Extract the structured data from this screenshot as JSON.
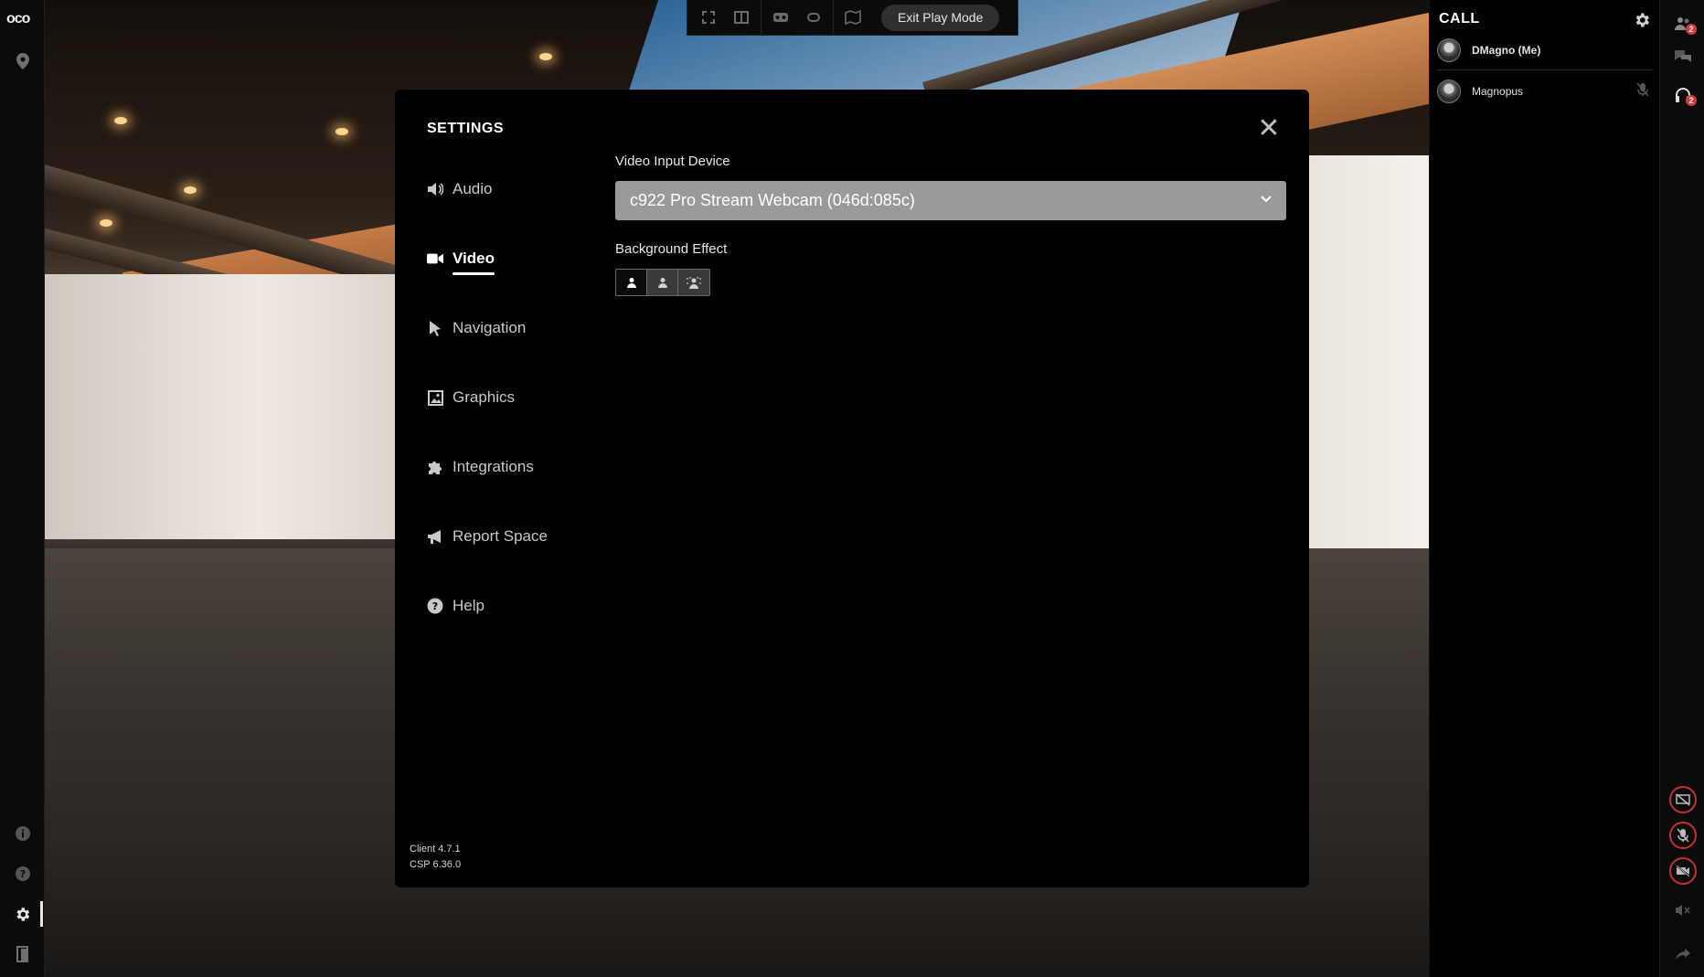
{
  "app": {
    "logo_text": "oco"
  },
  "toolbar": {
    "exit_label": "Exit Play Mode"
  },
  "left_rail": {
    "top_icons": [
      "location-pin-icon"
    ],
    "bottom_icons": [
      "info-icon",
      "help-icon",
      "gear-icon",
      "exit-door-icon"
    ],
    "active": "gear-icon"
  },
  "settings": {
    "title": "SETTINGS",
    "nav": [
      {
        "label": "Audio",
        "icon": "speaker-icon"
      },
      {
        "label": "Video",
        "icon": "video-camera-icon",
        "active": true
      },
      {
        "label": "Navigation",
        "icon": "pointer-icon"
      },
      {
        "label": "Graphics",
        "icon": "image-icon"
      },
      {
        "label": "Integrations",
        "icon": "puzzle-icon"
      },
      {
        "label": "Report Space",
        "icon": "megaphone-icon"
      },
      {
        "label": "Help",
        "icon": "help-circle-icon"
      }
    ],
    "video_input_label": "Video Input Device",
    "video_input_value": "c922 Pro Stream Webcam (046d:085c)",
    "background_effect_label": "Background Effect",
    "background_effect_options": [
      "none",
      "blur",
      "virtual-background"
    ],
    "background_effect_selected": "none",
    "client_version": "Client 4.7.1",
    "csp_version": "CSP 6.36.0"
  },
  "call": {
    "title": "CALL",
    "participants": [
      {
        "name": "DMagno (Me)"
      },
      {
        "name": "Magnopus",
        "muted": true
      }
    ]
  },
  "right_rail": {
    "participants_badge": "2",
    "audio_badge": "2"
  },
  "colors": {
    "accent_red": "#c43030",
    "badge_red": "#d23b3b",
    "select_bg": "#9a9a9a"
  }
}
